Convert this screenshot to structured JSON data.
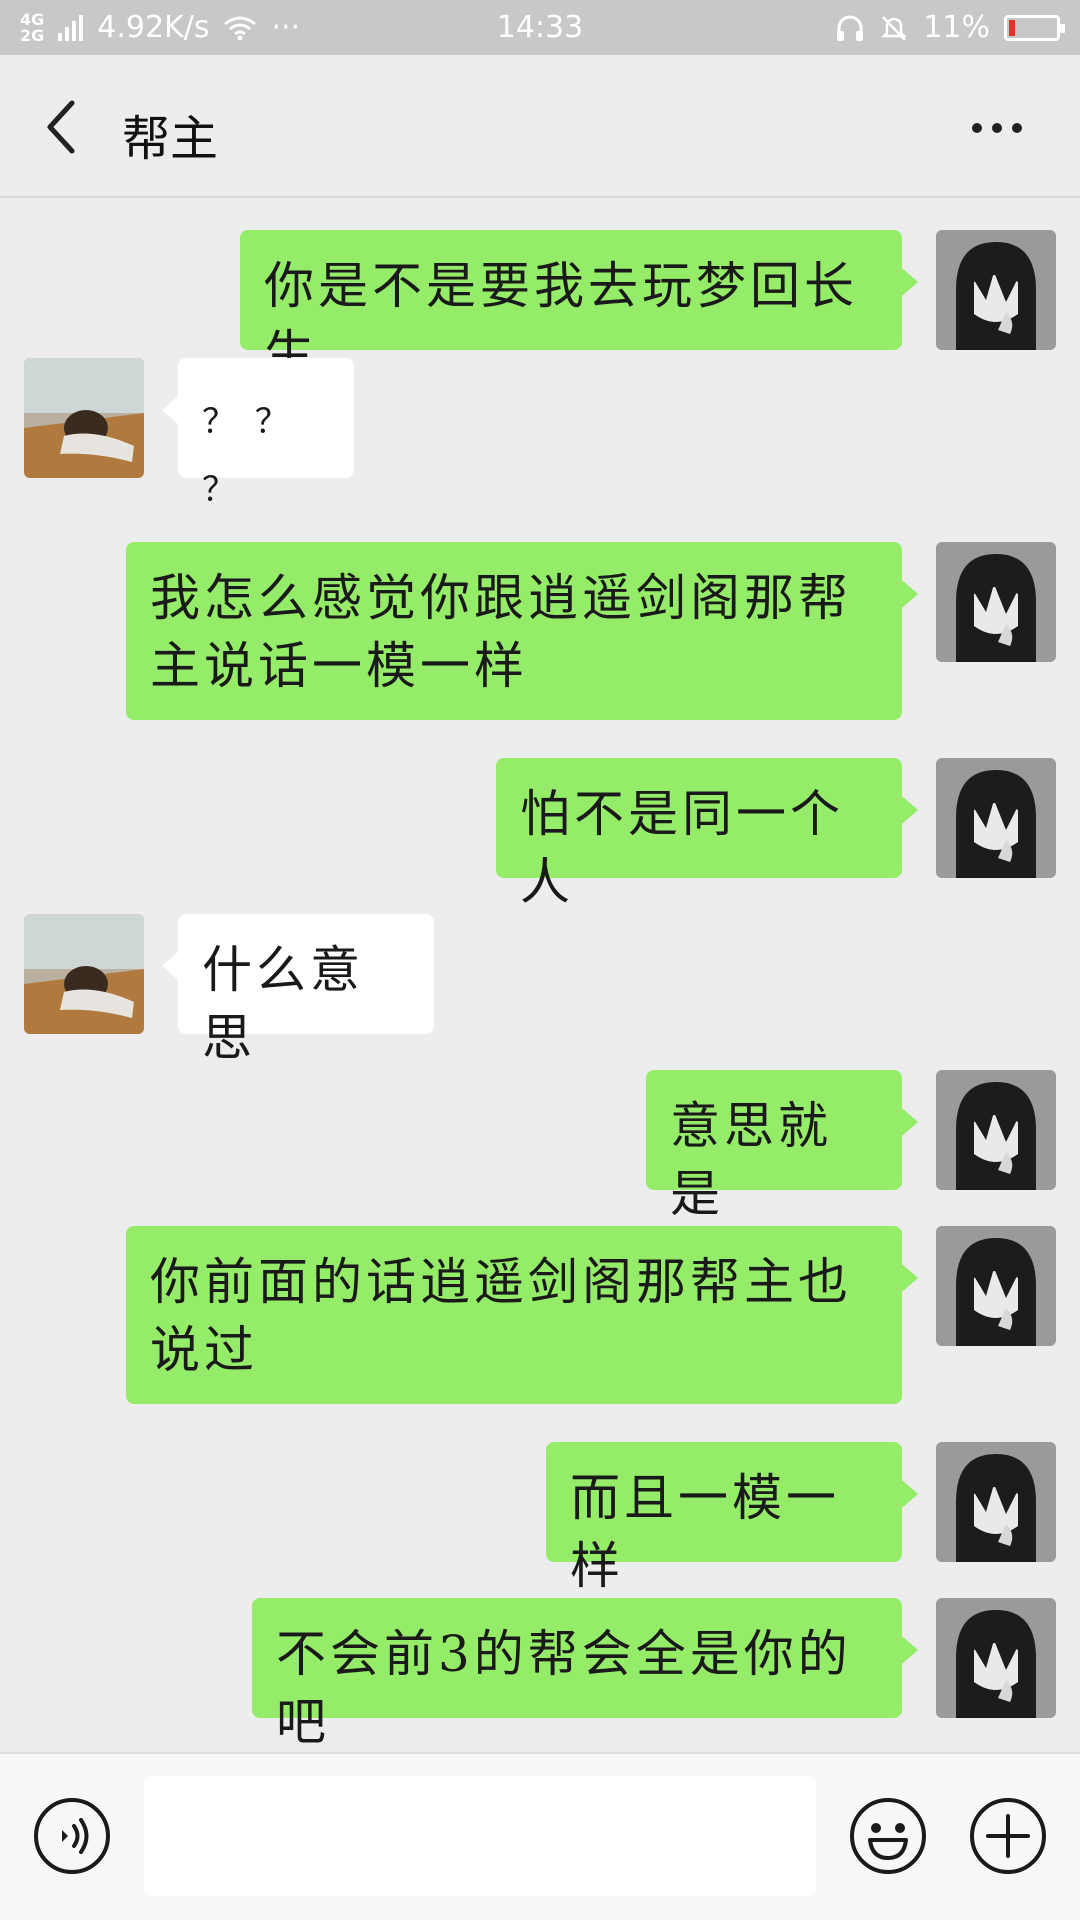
{
  "status_bar": {
    "network_top": "4G",
    "network_bottom": "2G",
    "speed": "4.92K/s",
    "dots": "···",
    "time": "14:33",
    "battery": "11%",
    "battery_level": 0.11,
    "battery_color": "#e5322d"
  },
  "header": {
    "back_icon": "chevron-left-icon",
    "title": "帮主",
    "more_icon": "more-horizontal-icon"
  },
  "messages": [
    {
      "side": "me",
      "text": "你是不是要我去玩梦回长生"
    },
    {
      "side": "other",
      "text": "？ ？ ？"
    },
    {
      "side": "me",
      "text": "我怎么感觉你跟逍遥剑阁那帮主说话一模一样"
    },
    {
      "side": "me",
      "text": "怕不是同一个人"
    },
    {
      "side": "other",
      "text": "什么意思"
    },
    {
      "side": "me",
      "text": "意思就是"
    },
    {
      "side": "me",
      "text": "你前面的话逍遥剑阁那帮主也说过"
    },
    {
      "side": "me",
      "text": "而且一模一样"
    },
    {
      "side": "me",
      "text": "不会前3的帮会全是你的吧"
    }
  ],
  "input_bar": {
    "voice_icon": "voice-icon",
    "input_value": "",
    "emoji_icon": "emoji-icon",
    "plus_icon": "plus-icon"
  },
  "colors": {
    "my_bubble": "#95ec69",
    "other_bubble": "#ffffff",
    "background": "#ededed"
  }
}
